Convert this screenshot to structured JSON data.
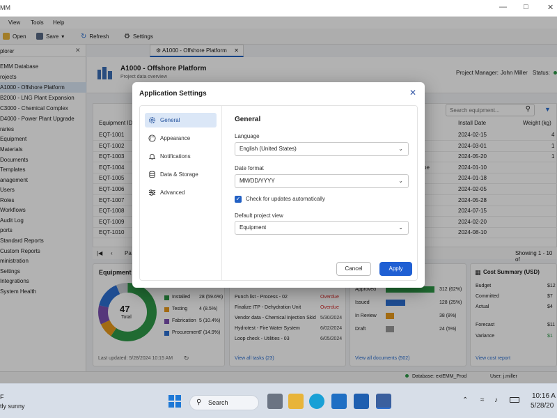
{
  "window": {
    "title_fragment": "MM"
  },
  "menu": [
    "View",
    "Tools",
    "Help"
  ],
  "toolbar": {
    "open": "Open",
    "save": "Save",
    "refresh": "Refresh",
    "settings": "Settings"
  },
  "sidebar": {
    "header": "plorer",
    "items": [
      {
        "label": "EMM Database"
      },
      {
        "label": "rojects"
      },
      {
        "label": "A1000 - Offshore Platform",
        "selected": true
      },
      {
        "label": "B2000 - LNG Plant Expansion"
      },
      {
        "label": "C3000 - Chemical Complex"
      },
      {
        "label": "D4000 - Power Plant Upgrade"
      },
      {
        "label": "raries"
      },
      {
        "label": "Equipment"
      },
      {
        "label": "Materials"
      },
      {
        "label": "Documents"
      },
      {
        "label": "Templates"
      },
      {
        "label": "anagement"
      },
      {
        "label": "Users"
      },
      {
        "label": "Roles"
      },
      {
        "label": "Workflows"
      },
      {
        "label": "Audit Log"
      },
      {
        "label": "ports"
      },
      {
        "label": "Standard Reports"
      },
      {
        "label": "Custom Reports"
      },
      {
        "label": "ministration"
      },
      {
        "label": "Settings"
      },
      {
        "label": "Integrations"
      },
      {
        "label": "System Health"
      }
    ]
  },
  "doc_tab": {
    "label": "A1000 - Offshore Platform"
  },
  "project": {
    "title": "A1000 - Offshore Platform",
    "subtitle": "Project data overview",
    "manager_label": "Project Manager:",
    "manager": "John Miller",
    "status_label": "Status:"
  },
  "table": {
    "search_placeholder": "Search equipment...",
    "headers": {
      "id": "Equipment ID",
      "r": "r",
      "install": "Install Date",
      "weight": "Weight (kg)"
    },
    "rows": [
      {
        "id": "EQT-1001",
        "install": "2024-02-15",
        "weight": "4",
        "extra": ""
      },
      {
        "id": "EQT-1002",
        "install": "2024-03-01",
        "weight": "1",
        "extra": ""
      },
      {
        "id": "EQT-1003",
        "install": "2024-05-20",
        "weight": "1",
        "extra": ""
      },
      {
        "id": "EQT-1004",
        "install": "2024-01-10",
        "weight": "",
        "extra": "oe"
      },
      {
        "id": "EQT-1005",
        "install": "2024-01-18",
        "weight": "",
        "extra": ""
      },
      {
        "id": "EQT-1006",
        "install": "2024-02-05",
        "weight": "",
        "extra": ""
      },
      {
        "id": "EQT-1007",
        "install": "2024-05-28",
        "weight": "",
        "extra": ""
      },
      {
        "id": "EQT-1008",
        "install": "2024-07-15",
        "weight": "",
        "extra": ""
      },
      {
        "id": "EQT-1009",
        "install": "2024-02-20",
        "weight": "",
        "extra": ""
      },
      {
        "id": "EQT-1010",
        "install": "2024-08-10",
        "weight": "",
        "extra": ""
      }
    ],
    "pager_text": "Pa",
    "showing": "Showing 1 - 10 of"
  },
  "equipment_card": {
    "title": "Equipment b",
    "total": "47",
    "total_label": "Total",
    "legend": [
      {
        "label": "Installed",
        "value": "28 (59.6%)",
        "color": "#2e9a48"
      },
      {
        "label": "Testing",
        "value": "4 (8.5%)",
        "color": "#e89a1c"
      },
      {
        "label": "Fabrication",
        "value": "5 (10.4%)",
        "color": "#7b4fb0"
      },
      {
        "label": "Procurement",
        "value": "7 (14.9%)",
        "color": "#2b6fd1"
      }
    ],
    "updated": "Last updated: 5/28/2024 10:15 AM"
  },
  "tasks_card": {
    "items": [
      {
        "label": "Punch list - Process - 02",
        "status": "Overdue"
      },
      {
        "label": "Finalize ITP - Dehydration Unit",
        "status": "Overdue"
      },
      {
        "label": "Vendor data - Chemical Injection Skid",
        "status": "5/30/2024"
      },
      {
        "label": "Hydrotest - Fire Water System",
        "status": "6/02/2024"
      },
      {
        "label": "Loop check - Utilities - 03",
        "status": "6/05/2024"
      }
    ],
    "link": "View all tasks (23)"
  },
  "docs_card": {
    "items": [
      {
        "label": "Approved",
        "value": "312 (62%)",
        "fill": 0.62,
        "color": "#2e9a48"
      },
      {
        "label": "Issued",
        "value": "128 (25%)",
        "fill": 0.25,
        "color": "#2b6fd1"
      },
      {
        "label": "In Review",
        "value": "38 (8%)",
        "fill": 0.08,
        "color": "#e89a1c"
      },
      {
        "label": "Draft",
        "value": "24 (5%)",
        "fill": 0.05,
        "color": "#9a9a9a"
      }
    ],
    "link": "View all documents (502)"
  },
  "cost_card": {
    "title": "Cost Summary (USD)",
    "rows": [
      {
        "label": "Budget",
        "value": "$12"
      },
      {
        "label": "Committed",
        "value": "$7"
      },
      {
        "label": "Actual",
        "value": "$4"
      },
      {
        "label": "Forecast",
        "value": "$11"
      },
      {
        "label": "Variance",
        "value": "$1"
      }
    ],
    "link": "View cost report"
  },
  "statusbar": {
    "database": "Database:  extEMM_Prod",
    "user": "User:  j.miller"
  },
  "dialog": {
    "title": "Application Settings",
    "nav": [
      {
        "label": "General",
        "icon": "gear-icon",
        "active": true
      },
      {
        "label": "Appearance",
        "icon": "palette-icon"
      },
      {
        "label": "Notifications",
        "icon": "bell-icon"
      },
      {
        "label": "Data & Storage",
        "icon": "database-icon"
      },
      {
        "label": "Advanced",
        "icon": "sliders-icon"
      }
    ],
    "section": "General",
    "language_label": "Language",
    "language_value": "English (United States)",
    "date_label": "Date format",
    "date_value": "MM/DD/YYYY",
    "updates_label": "Check for updates automatically",
    "updates_checked": true,
    "view_label": "Default project view",
    "view_value": "Equipment",
    "cancel": "Cancel",
    "apply": "Apply"
  },
  "taskbar": {
    "weather_temp": "F",
    "weather_text": "tly sunny",
    "search": "Search",
    "time": "10:16 A",
    "date": "5/28/20"
  }
}
